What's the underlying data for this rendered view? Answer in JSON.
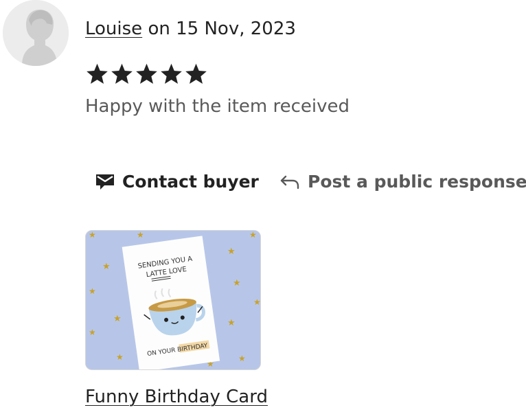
{
  "review": {
    "reviewer_name": "Louise",
    "date_prefix": " on ",
    "date": "15 Nov, 2023",
    "rating": 5,
    "rating_max": 5,
    "text": "Happy with the item received"
  },
  "actions": {
    "contact_buyer_label": "Contact buyer",
    "contact_icon": "envelope-icon",
    "public_response_label": "Post a public response",
    "public_response_icon": "reply-arrow-icon"
  },
  "item": {
    "card_line1": "SENDING YOU A",
    "card_line2": "LATTE LOVE",
    "card_line3": "ON YOUR BIRTHDAY",
    "link_label": "Funny Birthday Card"
  },
  "colors": {
    "text": "#222222",
    "muted": "#595959",
    "thumb_bg": "#b7c6e8",
    "star_gold": "#c9a227"
  }
}
